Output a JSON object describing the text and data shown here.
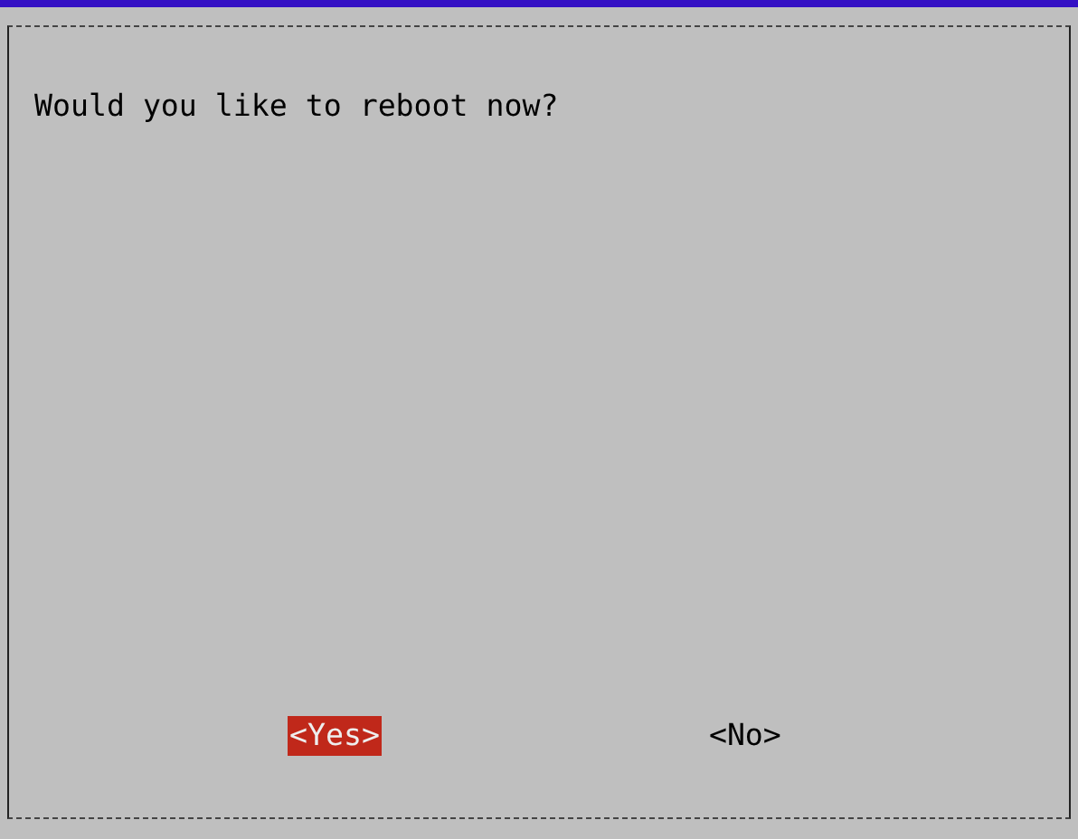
{
  "dialog": {
    "message": "Would you like to reboot now?",
    "buttons": [
      {
        "label": "<Yes>",
        "selected": true
      },
      {
        "label": "<No>",
        "selected": false
      }
    ]
  }
}
